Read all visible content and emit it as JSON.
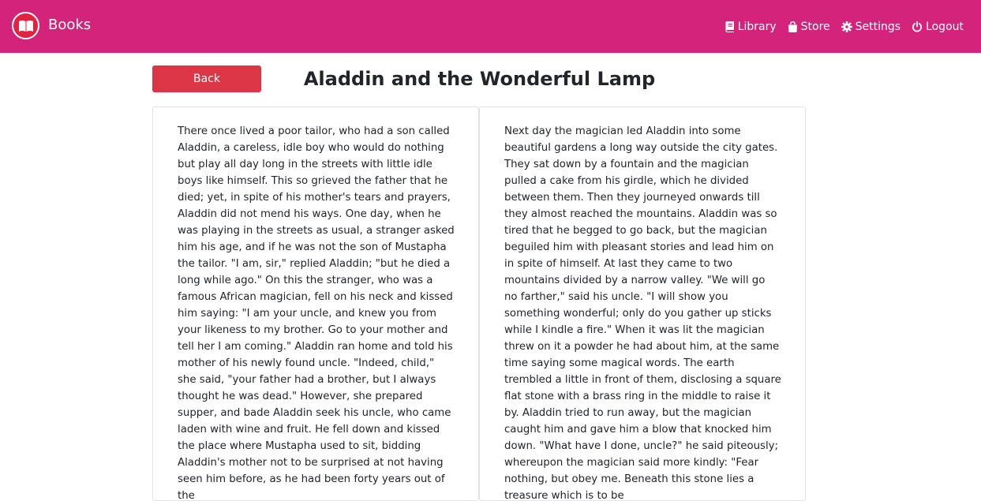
{
  "header": {
    "brand_name": "Books",
    "nav": {
      "library": "Library",
      "store": "Store",
      "settings": "Settings",
      "logout": "Logout"
    },
    "colors": {
      "background": "#d4237b",
      "logo": "#e2223f"
    }
  },
  "book": {
    "back_label": "Back",
    "title": "Aladdin and the Wonderful Lamp",
    "left_page": "There once lived a poor tailor, who had a son called Aladdin, a careless, idle boy who would do nothing but play all day long in the streets with little idle boys like himself. This so grieved the father that he died; yet, in spite of his mother's tears and prayers, Aladdin did not mend his ways. One day, when he was playing in the streets as usual, a stranger asked him his age, and if he was not the son of Mustapha the tailor. \"I am, sir,\" replied Aladdin; \"but he died a long while ago.\" On this the stranger, who was a famous African magician, fell on his neck and kissed him saying: \"I am your uncle, and knew you from your likeness to my brother. Go to your mother and tell her I am coming.\" Aladdin ran home and told his mother of his newly found uncle. \"Indeed, child,\" she said, \"your father had a brother, but I always thought he was dead.\" However, she prepared supper, and bade Aladdin seek his uncle, who came laden with wine and fruit. He fell down and kissed the place where Mustapha used to sit, bidding Aladdin's mother not to be surprised at not having seen him before, as he had been forty years out of the",
    "right_page": "Next day the magician led Aladdin into some beautiful gardens a long way outside the city gates. They sat down by a fountain and the magician pulled a cake from his girdle, which he divided between them. Then they journeyed onwards till they almost reached the mountains. Aladdin was so tired that he begged to go back, but the magician beguiled him with pleasant stories and lead him on in spite of himself. At last they came to two mountains divided by a narrow valley. \"We will go no farther,\" said his uncle. \"I will show you something wonderful; only do you gather up sticks while I kindle a fire.\" When it was lit the magician threw on it a powder he had about him, at the same time saying some magical words. The earth trembled a little in front of them, disclosing a square flat stone with a brass ring in the middle to raise it by. Aladdin tried to run away, but the magician caught him and gave him a blow that knocked him down. \"What have I done, uncle?\" he said piteously; whereupon the magician said more kindly: \"Fear nothing, but obey me. Beneath this stone lies a treasure which is to be",
    "colors": {
      "back_button": "#dc3545"
    }
  }
}
